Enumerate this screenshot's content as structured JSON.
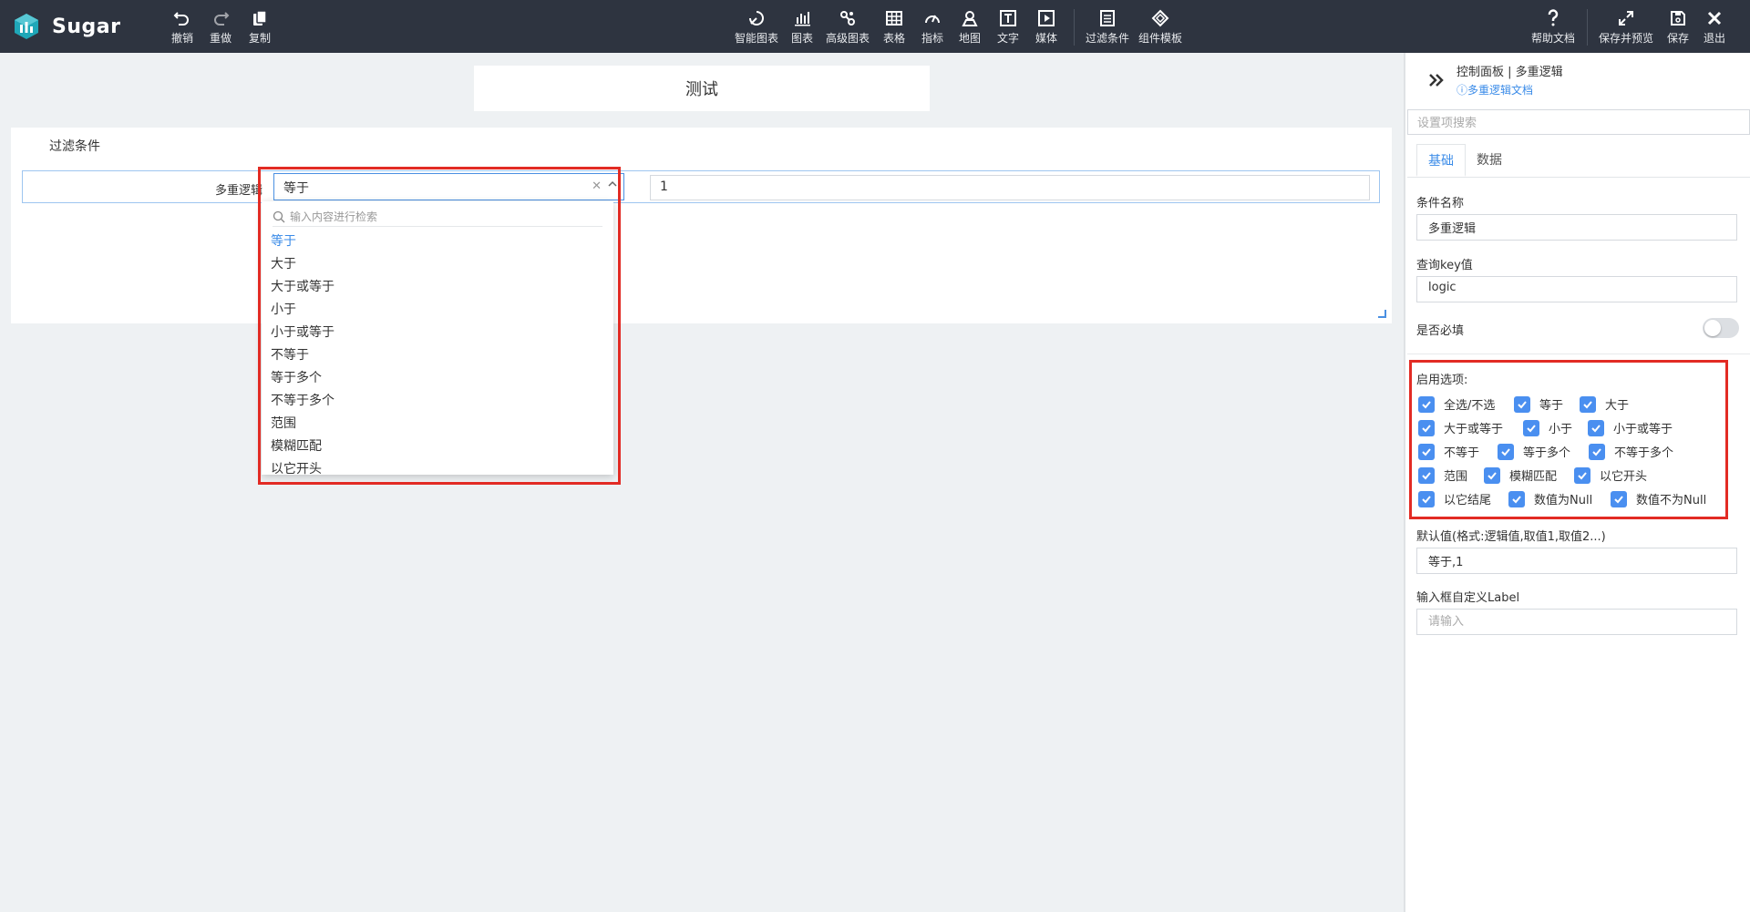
{
  "app": {
    "name": "Sugar"
  },
  "toolbar": {
    "left": [
      {
        "label": "撤销",
        "icon": "undo-icon"
      },
      {
        "label": "重做",
        "icon": "redo-icon"
      },
      {
        "label": "复制",
        "icon": "copy-icon"
      }
    ],
    "center": [
      {
        "label": "智能图表",
        "icon": "smart-chart-icon"
      },
      {
        "label": "图表",
        "icon": "bar-chart-icon"
      },
      {
        "label": "高级图表",
        "icon": "advanced-chart-icon"
      },
      {
        "label": "表格",
        "icon": "table-icon"
      },
      {
        "label": "指标",
        "icon": "gauge-icon"
      },
      {
        "label": "地图",
        "icon": "map-pin-icon"
      },
      {
        "label": "文字",
        "icon": "text-icon"
      },
      {
        "label": "媒体",
        "icon": "media-icon"
      },
      {
        "label": "过滤条件",
        "icon": "filter-icon"
      },
      {
        "label": "组件模板",
        "icon": "template-icon"
      }
    ],
    "right": [
      {
        "label": "帮助文档",
        "icon": "help-icon"
      },
      {
        "label": "保存并预览",
        "icon": "expand-icon"
      },
      {
        "label": "保存",
        "icon": "save-icon"
      },
      {
        "label": "退出",
        "icon": "close-icon"
      }
    ]
  },
  "canvas": {
    "title": "测试",
    "panel": {
      "title": "过滤条件",
      "row_label": "多重逻辑",
      "select_value": "等于",
      "input_value": "1"
    }
  },
  "dropdown": {
    "search_placeholder": "输入内容进行检索",
    "options": [
      "等于",
      "大于",
      "大于或等于",
      "小于",
      "小于或等于",
      "不等于",
      "等于多个",
      "不等于多个",
      "范围",
      "模糊匹配",
      "以它开头"
    ],
    "selected": "等于"
  },
  "sidebar": {
    "title": "控制面板 | 多重逻辑",
    "doc_link": "ⓘ多重逻辑文档",
    "search_placeholder": "设置项搜索",
    "tabs": [
      "基础",
      "数据"
    ],
    "active_tab": "基础",
    "fields": {
      "name_label": "条件名称",
      "name_value": "多重逻辑",
      "key_label": "查询key值",
      "key_value": "logic",
      "required_label": "是否必填",
      "options_label": "启用选项:",
      "default_label": "默认值(格式:逻辑值,取值1,取值2...)",
      "default_value": "等于,1",
      "custom_label_label": "输入框自定义Label",
      "custom_label_placeholder": "请输入"
    },
    "options": [
      "全选/不选",
      "等于",
      "大于",
      "大于或等于",
      "小于",
      "小于或等于",
      "不等于",
      "等于多个",
      "不等于多个",
      "范围",
      "模糊匹配",
      "以它开头",
      "以它结尾",
      "数值为Null",
      "数值不为Null"
    ]
  },
  "colors": {
    "accent": "#3a8be8",
    "topbar": "#2e3440",
    "highlight": "#e22b24",
    "checkbox": "#4a8ff0"
  }
}
